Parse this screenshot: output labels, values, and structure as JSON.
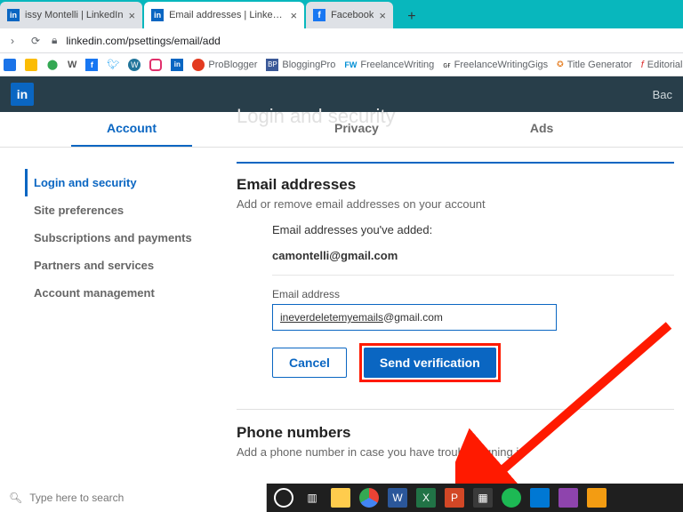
{
  "browser": {
    "tabs": [
      {
        "title": "issy Montelli | LinkedIn",
        "icon": "in",
        "iconBg": "#0a66c2",
        "iconFg": "#fff"
      },
      {
        "title": "Email addresses | LinkedIn",
        "icon": "in",
        "iconBg": "#0a66c2",
        "iconFg": "#fff",
        "active": true
      },
      {
        "title": "Facebook",
        "icon": "f",
        "iconBg": "#1877f2",
        "iconFg": "#fff"
      }
    ],
    "url": "linkedin.com/psettings/email/add",
    "bookmarks": [
      {
        "label": "",
        "color": "#1a73e8"
      },
      {
        "label": "",
        "color": "#fbbc04"
      },
      {
        "label": "",
        "color": "#34a853"
      },
      {
        "label": "W",
        "color": "#555"
      },
      {
        "label": "f",
        "color": "#1877f2"
      },
      {
        "label": "",
        "color": "#1da1f2"
      },
      {
        "label": "W",
        "color": "#21759b"
      },
      {
        "label": "",
        "color": "#e1306c"
      },
      {
        "label": "in",
        "color": "#0a66c2"
      },
      {
        "label": "ProBlogger",
        "color": "#e33b20"
      },
      {
        "label": "BloggingPro",
        "color": "#3b5998"
      },
      {
        "label": "FreelanceWriting",
        "color": "#008fd5"
      },
      {
        "label": "FreelanceWritingGigs",
        "color": "#333"
      },
      {
        "label": "Title Generator",
        "color": "#e67e22"
      },
      {
        "label": "Editorial",
        "color": "#333"
      }
    ]
  },
  "header": {
    "back": "Bac"
  },
  "tabsNav": {
    "items": [
      "Account",
      "Privacy",
      "Ads"
    ],
    "selected": 0,
    "ghost": "Login and security"
  },
  "sidebar": {
    "items": [
      "Login and security",
      "Site preferences",
      "Subscriptions and payments",
      "Partners and services",
      "Account management"
    ],
    "selected": 0
  },
  "emailSection": {
    "title": "Email addresses",
    "sub": "Add or remove email addresses on your account",
    "addedLabel": "Email addresses you've added:",
    "existing": "camontelli@gmail.com",
    "fieldLabel": "Email address",
    "inputValue": "ineverdeletemyemails@gmail.com",
    "cancel": "Cancel",
    "send": "Send verification"
  },
  "phoneSection": {
    "title": "Phone numbers",
    "sub": "Add a phone number in case you have trouble signing in"
  },
  "taskbar": {
    "search": "Type here to search"
  }
}
